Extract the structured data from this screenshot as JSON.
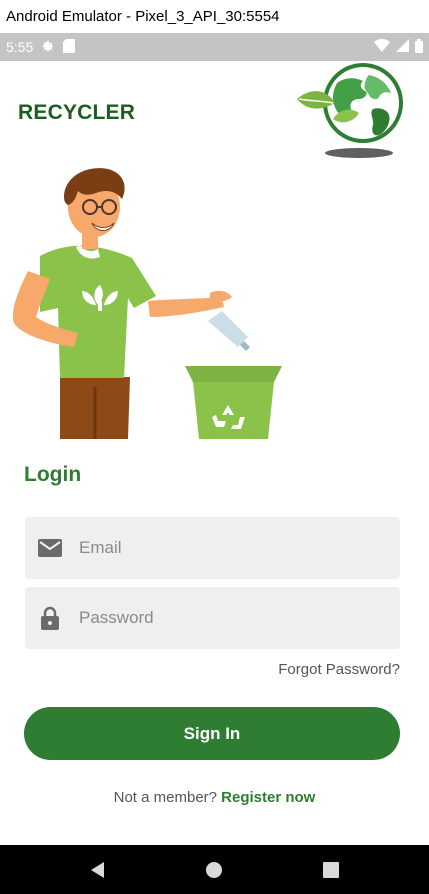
{
  "window": {
    "title": "Android Emulator - Pixel_3_API_30:5554"
  },
  "status_bar": {
    "time": "5:55"
  },
  "app": {
    "brand": "RECYCLER",
    "login_title": "Login",
    "email": {
      "placeholder": "Email",
      "value": ""
    },
    "password": {
      "placeholder": "Password",
      "value": ""
    },
    "forgot_label": "Forgot Password?",
    "signin_label": "Sign In",
    "register_prompt": "Not a member?",
    "register_link": "Register now"
  },
  "colors": {
    "primary": "#2e7d32",
    "brand": "#1b5e20",
    "field_bg": "#efefef",
    "accent_green": "#8bc34a"
  },
  "icons": [
    "settings-icon",
    "sd-card-icon",
    "wifi-icon",
    "signal-icon",
    "battery-icon",
    "globe-logo-icon",
    "mail-icon",
    "lock-icon",
    "back-icon",
    "home-icon",
    "recents-icon"
  ]
}
